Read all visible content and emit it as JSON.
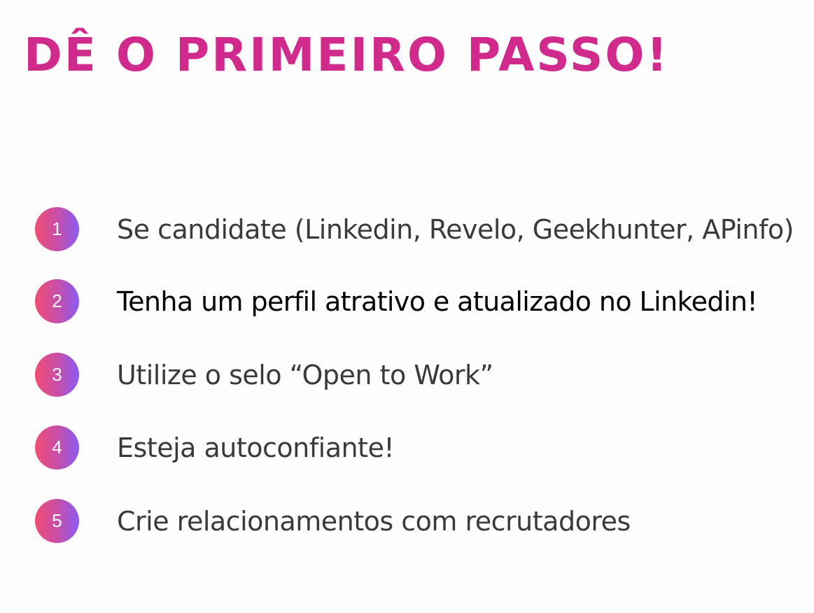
{
  "title": "DÊ O PRIMEIRO PASSO!",
  "steps": [
    {
      "number": "1",
      "text": "Se candidate (Linkedin, Revelo, Geekhunter, APinfo)"
    },
    {
      "number": "2",
      "text": "Tenha um perfil atrativo e atualizado no Linkedin!"
    },
    {
      "number": "3",
      "text": "Utilize o selo “Open to Work”"
    },
    {
      "number": "4",
      "text": "Esteja autoconfiante!"
    },
    {
      "number": "5",
      "text": "Crie relacionamentos com recrutadores"
    }
  ],
  "colors": {
    "title": "#d02a8c",
    "badge_gradient_start": "#f04e73",
    "badge_gradient_end": "#8a5cf2",
    "highlighted_text": "#000000",
    "body_text": "#3a3a3a"
  }
}
